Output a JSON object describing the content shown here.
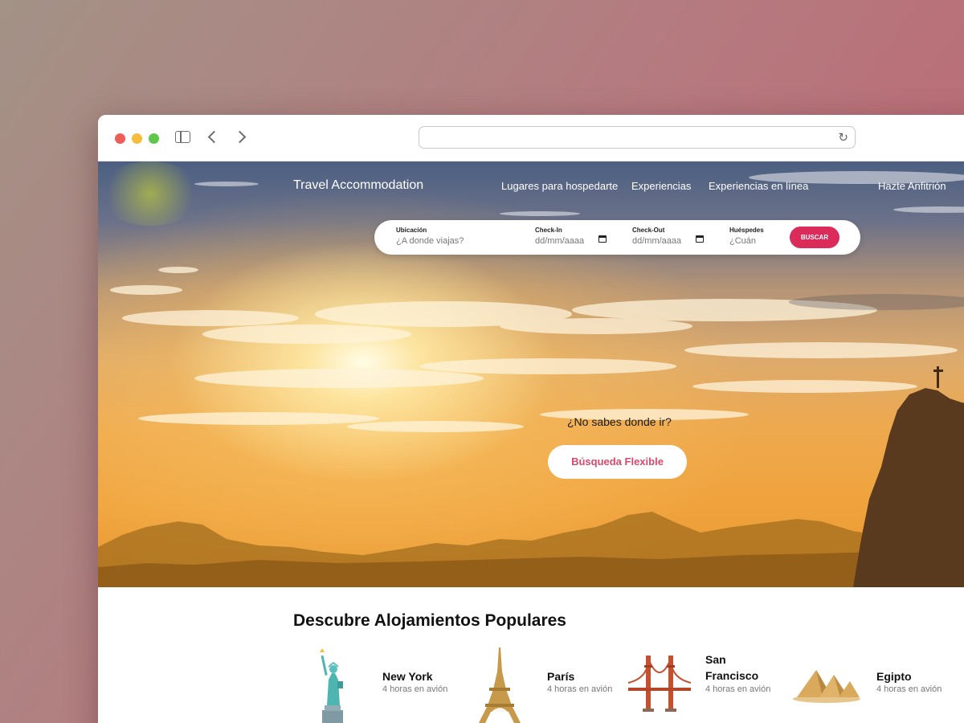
{
  "window": {
    "controls": [
      "close",
      "minimize",
      "maximize"
    ],
    "url": ""
  },
  "site": {
    "brand": "Travel Accommodation",
    "nav": [
      "Lugares para hospedarte",
      "Experiencias",
      "Experiencias en línea"
    ],
    "host_link": "Hazte Anfitrión"
  },
  "search": {
    "location_label": "Ubicación",
    "location_placeholder": "¿A donde viajas?",
    "checkin_label": "Check-In",
    "checkin_value": "dd/mm/aaaa",
    "checkout_label": "Check-Out",
    "checkout_value": "dd/mm/aaaa",
    "guests_label": "Huéspedes",
    "guests_placeholder": "¿Cuán",
    "button": "BUSCAR"
  },
  "hero": {
    "question": "¿No sabes donde ir?",
    "flex_button": "Búsqueda Flexible"
  },
  "popular": {
    "title": "Descubre Alojamientos Populares",
    "destinations": [
      {
        "name": "New York",
        "sub": "4 horas en avión",
        "icon": "statue-of-liberty-icon"
      },
      {
        "name": "París",
        "sub": "4 horas en avión",
        "icon": "eiffel-tower-icon"
      },
      {
        "name": "San Francisco",
        "sub": "4 horas en avión",
        "icon": "golden-gate-icon"
      },
      {
        "name": "Egipto",
        "sub": "4 horas en avión",
        "icon": "pyramids-icon"
      }
    ]
  },
  "colors": {
    "accent": "#da2b5a",
    "flex_text": "#d8496c"
  }
}
